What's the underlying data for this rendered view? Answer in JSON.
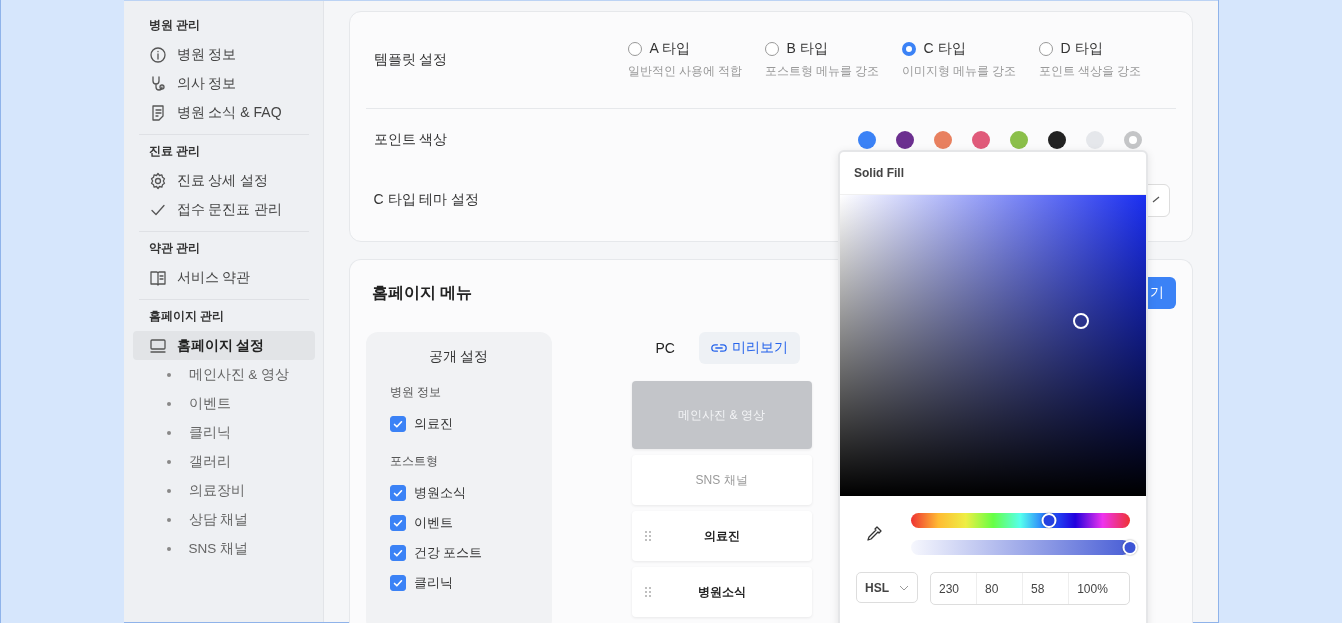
{
  "sidebar": {
    "sections": [
      {
        "title": "병원 관리",
        "items": [
          {
            "label": "병원 정보",
            "selected": false
          },
          {
            "label": "의사 정보",
            "selected": false
          },
          {
            "label": "병원 소식 & FAQ",
            "selected": false
          }
        ]
      },
      {
        "title": "진료 관리",
        "items": [
          {
            "label": "진료 상세 설정",
            "selected": false
          },
          {
            "label": "접수 문진표 관리",
            "selected": false
          }
        ]
      },
      {
        "title": "약관 관리",
        "items": [
          {
            "label": "서비스 약관",
            "selected": false
          }
        ]
      },
      {
        "title": "홈페이지 관리",
        "items": [
          {
            "label": "홈페이지 설정",
            "selected": true,
            "children": [
              {
                "label": "메인사진 & 영상"
              },
              {
                "label": "이벤트"
              },
              {
                "label": "클리닉"
              },
              {
                "label": "갤러리"
              },
              {
                "label": "의료장비"
              },
              {
                "label": "상담 채널"
              },
              {
                "label": "SNS 채널"
              }
            ]
          }
        ]
      }
    ]
  },
  "template": {
    "label": "템플릿 설정",
    "options": [
      {
        "label": "A 타입",
        "hint": "일반적인 사용에 적합",
        "selected": false
      },
      {
        "label": "B 타입",
        "hint": "포스트형 메뉴를 강조",
        "selected": false
      },
      {
        "label": "C 타입",
        "hint": "이미지형 메뉴를 강조",
        "selected": true
      },
      {
        "label": "D 타입",
        "hint": "포인트 색상을 강조",
        "selected": false
      }
    ]
  },
  "point_color": {
    "label": "포인트 색상",
    "swatches": [
      {
        "color": "#3b82f6",
        "selected": false
      },
      {
        "color": "#6b2f8f",
        "selected": false
      },
      {
        "color": "#e8805f",
        "selected": false
      },
      {
        "color": "#e05a7a",
        "selected": false
      },
      {
        "color": "#8bbf4a",
        "selected": false
      },
      {
        "color": "#222222",
        "selected": false
      },
      {
        "color": "#e5e7eb",
        "selected": false
      },
      {
        "color": "#c4c5c7",
        "selected": true
      }
    ]
  },
  "theme": {
    "label": "C 타입 테마 설정"
  },
  "homepage_menu": {
    "title": "홈페이지 메뉴",
    "button": "기",
    "visibility": {
      "title": "공개 설정",
      "groups": [
        {
          "title": "병원 정보",
          "items": [
            {
              "label": "의료진",
              "checked": true
            }
          ]
        },
        {
          "title": "포스트형",
          "items": [
            {
              "label": "병원소식",
              "checked": true
            },
            {
              "label": "이벤트",
              "checked": true
            },
            {
              "label": "건강 포스트",
              "checked": true
            },
            {
              "label": "클리닉",
              "checked": true
            }
          ]
        }
      ]
    },
    "preview": {
      "tab": "PC",
      "link": "미리보기",
      "items": [
        {
          "label": "메인사진 & 영상",
          "kind": "banner"
        },
        {
          "label": "SNS 채널",
          "kind": "fixed"
        },
        {
          "label": "의료진",
          "kind": "draggable"
        },
        {
          "label": "병원소식",
          "kind": "draggable"
        }
      ]
    }
  },
  "color_picker": {
    "title": "Solid Fill",
    "hue": {
      "level": 0.63
    },
    "alpha": {
      "level": 1
    },
    "mode": "HSL",
    "values": [
      "230",
      "80",
      "58",
      "100%"
    ]
  }
}
